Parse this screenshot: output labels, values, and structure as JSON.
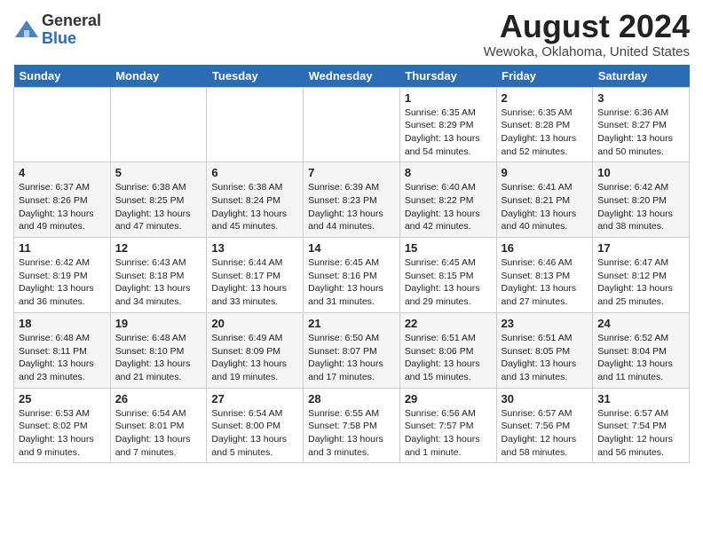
{
  "header": {
    "logo_line1": "General",
    "logo_line2": "Blue",
    "month": "August 2024",
    "location": "Wewoka, Oklahoma, United States"
  },
  "weekdays": [
    "Sunday",
    "Monday",
    "Tuesday",
    "Wednesday",
    "Thursday",
    "Friday",
    "Saturday"
  ],
  "weeks": [
    [
      {
        "day": "",
        "info": ""
      },
      {
        "day": "",
        "info": ""
      },
      {
        "day": "",
        "info": ""
      },
      {
        "day": "",
        "info": ""
      },
      {
        "day": "1",
        "info": "Sunrise: 6:35 AM\nSunset: 8:29 PM\nDaylight: 13 hours\nand 54 minutes."
      },
      {
        "day": "2",
        "info": "Sunrise: 6:35 AM\nSunset: 8:28 PM\nDaylight: 13 hours\nand 52 minutes."
      },
      {
        "day": "3",
        "info": "Sunrise: 6:36 AM\nSunset: 8:27 PM\nDaylight: 13 hours\nand 50 minutes."
      }
    ],
    [
      {
        "day": "4",
        "info": "Sunrise: 6:37 AM\nSunset: 8:26 PM\nDaylight: 13 hours\nand 49 minutes."
      },
      {
        "day": "5",
        "info": "Sunrise: 6:38 AM\nSunset: 8:25 PM\nDaylight: 13 hours\nand 47 minutes."
      },
      {
        "day": "6",
        "info": "Sunrise: 6:38 AM\nSunset: 8:24 PM\nDaylight: 13 hours\nand 45 minutes."
      },
      {
        "day": "7",
        "info": "Sunrise: 6:39 AM\nSunset: 8:23 PM\nDaylight: 13 hours\nand 44 minutes."
      },
      {
        "day": "8",
        "info": "Sunrise: 6:40 AM\nSunset: 8:22 PM\nDaylight: 13 hours\nand 42 minutes."
      },
      {
        "day": "9",
        "info": "Sunrise: 6:41 AM\nSunset: 8:21 PM\nDaylight: 13 hours\nand 40 minutes."
      },
      {
        "day": "10",
        "info": "Sunrise: 6:42 AM\nSunset: 8:20 PM\nDaylight: 13 hours\nand 38 minutes."
      }
    ],
    [
      {
        "day": "11",
        "info": "Sunrise: 6:42 AM\nSunset: 8:19 PM\nDaylight: 13 hours\nand 36 minutes."
      },
      {
        "day": "12",
        "info": "Sunrise: 6:43 AM\nSunset: 8:18 PM\nDaylight: 13 hours\nand 34 minutes."
      },
      {
        "day": "13",
        "info": "Sunrise: 6:44 AM\nSunset: 8:17 PM\nDaylight: 13 hours\nand 33 minutes."
      },
      {
        "day": "14",
        "info": "Sunrise: 6:45 AM\nSunset: 8:16 PM\nDaylight: 13 hours\nand 31 minutes."
      },
      {
        "day": "15",
        "info": "Sunrise: 6:45 AM\nSunset: 8:15 PM\nDaylight: 13 hours\nand 29 minutes."
      },
      {
        "day": "16",
        "info": "Sunrise: 6:46 AM\nSunset: 8:13 PM\nDaylight: 13 hours\nand 27 minutes."
      },
      {
        "day": "17",
        "info": "Sunrise: 6:47 AM\nSunset: 8:12 PM\nDaylight: 13 hours\nand 25 minutes."
      }
    ],
    [
      {
        "day": "18",
        "info": "Sunrise: 6:48 AM\nSunset: 8:11 PM\nDaylight: 13 hours\nand 23 minutes."
      },
      {
        "day": "19",
        "info": "Sunrise: 6:48 AM\nSunset: 8:10 PM\nDaylight: 13 hours\nand 21 minutes."
      },
      {
        "day": "20",
        "info": "Sunrise: 6:49 AM\nSunset: 8:09 PM\nDaylight: 13 hours\nand 19 minutes."
      },
      {
        "day": "21",
        "info": "Sunrise: 6:50 AM\nSunset: 8:07 PM\nDaylight: 13 hours\nand 17 minutes."
      },
      {
        "day": "22",
        "info": "Sunrise: 6:51 AM\nSunset: 8:06 PM\nDaylight: 13 hours\nand 15 minutes."
      },
      {
        "day": "23",
        "info": "Sunrise: 6:51 AM\nSunset: 8:05 PM\nDaylight: 13 hours\nand 13 minutes."
      },
      {
        "day": "24",
        "info": "Sunrise: 6:52 AM\nSunset: 8:04 PM\nDaylight: 13 hours\nand 11 minutes."
      }
    ],
    [
      {
        "day": "25",
        "info": "Sunrise: 6:53 AM\nSunset: 8:02 PM\nDaylight: 13 hours\nand 9 minutes."
      },
      {
        "day": "26",
        "info": "Sunrise: 6:54 AM\nSunset: 8:01 PM\nDaylight: 13 hours\nand 7 minutes."
      },
      {
        "day": "27",
        "info": "Sunrise: 6:54 AM\nSunset: 8:00 PM\nDaylight: 13 hours\nand 5 minutes."
      },
      {
        "day": "28",
        "info": "Sunrise: 6:55 AM\nSunset: 7:58 PM\nDaylight: 13 hours\nand 3 minutes."
      },
      {
        "day": "29",
        "info": "Sunrise: 6:56 AM\nSunset: 7:57 PM\nDaylight: 13 hours\nand 1 minute."
      },
      {
        "day": "30",
        "info": "Sunrise: 6:57 AM\nSunset: 7:56 PM\nDaylight: 12 hours\nand 58 minutes."
      },
      {
        "day": "31",
        "info": "Sunrise: 6:57 AM\nSunset: 7:54 PM\nDaylight: 12 hours\nand 56 minutes."
      }
    ]
  ]
}
